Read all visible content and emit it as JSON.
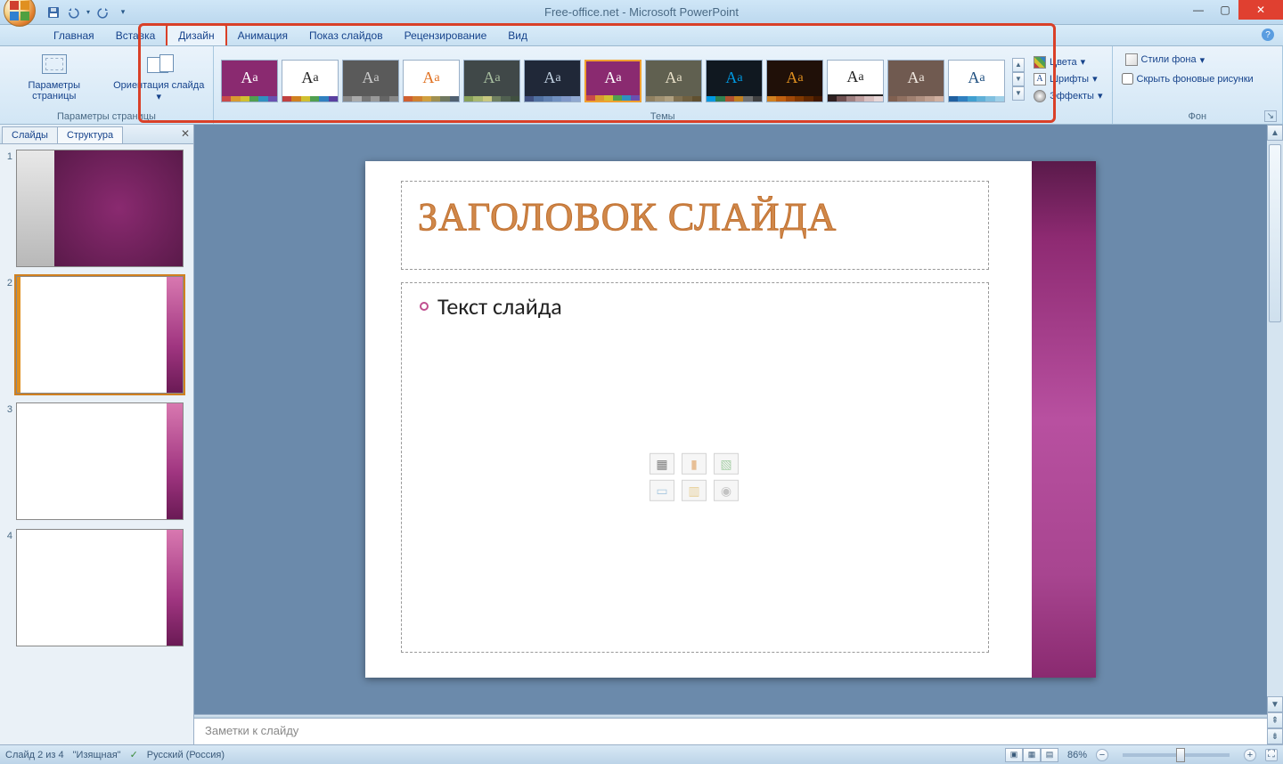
{
  "title": "Free-office.net - Microsoft PowerPoint",
  "tabs": {
    "home": "Главная",
    "insert": "Вставка",
    "design": "Дизайн",
    "animation": "Анимация",
    "slideshow": "Показ слайдов",
    "review": "Рецензирование",
    "view": "Вид"
  },
  "ribbon": {
    "page_setup_group": "Параметры страницы",
    "page_setup": "Параметры страницы",
    "orientation": "Ориентация слайда",
    "themes_group": "Темы",
    "colors": "Цвета",
    "fonts": "Шрифты",
    "effects": "Эффекты",
    "bg_group": "Фон",
    "bg_styles": "Стили фона",
    "hide_bg": "Скрыть фоновые рисунки"
  },
  "theme_thumbs": [
    {
      "bg": "#8a2a70",
      "fg": "#ffffff",
      "bar": [
        "#c94a4a",
        "#d99a30",
        "#d0c030",
        "#50a050",
        "#3090c0",
        "#6a50b0"
      ]
    },
    {
      "bg": "#ffffff",
      "fg": "#222222",
      "bar": [
        "#c04040",
        "#d08020",
        "#d0c030",
        "#50a050",
        "#3080c0",
        "#5a40a0"
      ]
    },
    {
      "bg": "#5a5a5a",
      "fg": "#cccccc",
      "bar": [
        "#888",
        "#aaa",
        "#777",
        "#999",
        "#666",
        "#888"
      ]
    },
    {
      "bg": "#ffffff",
      "fg": "#e07020",
      "bar": [
        "#d06030",
        "#d08030",
        "#d0a040",
        "#a09050",
        "#707860",
        "#506070"
      ]
    },
    {
      "bg": "#404848",
      "fg": "#a8bfa0",
      "bar": [
        "#88a058",
        "#a8b870",
        "#c8c880",
        "#708060",
        "#506050",
        "#405040"
      ]
    },
    {
      "bg": "#202838",
      "fg": "#c0d0e0",
      "bar": [
        "#405080",
        "#5070a0",
        "#6080b0",
        "#7090c0",
        "#8098c8",
        "#90a8d0"
      ]
    },
    {
      "bg": "#8a2a70",
      "fg": "#ffffff",
      "bar": [
        "#c94a4a",
        "#d99a30",
        "#d0c030",
        "#50a050",
        "#3090c0",
        "#6a50b0"
      ],
      "selected": true
    },
    {
      "bg": "#606050",
      "fg": "#e8e0c8",
      "bar": [
        "#908060",
        "#a09070",
        "#b0a080",
        "#807050",
        "#706040",
        "#605030"
      ]
    },
    {
      "bg": "#101820",
      "fg": "#0098e0",
      "bar": [
        "#0098e0",
        "#308050",
        "#b05030",
        "#c08020",
        "#707070",
        "#404040"
      ]
    },
    {
      "bg": "#201008",
      "fg": "#e09020",
      "bar": [
        "#d08020",
        "#c06010",
        "#a04808",
        "#803800",
        "#602800",
        "#401800"
      ]
    },
    {
      "bg": "#ffffff",
      "fg": "#222222",
      "bar": [
        "#302020",
        "#705050",
        "#a08080",
        "#c0a0a0",
        "#d8c0c0",
        "#e8d8d8"
      ],
      "under": true
    },
    {
      "bg": "#705a50",
      "fg": "#f0e8e0",
      "bar": [
        "#806050",
        "#907060",
        "#a08070",
        "#b09080",
        "#c0a090",
        "#d0b0a0"
      ]
    },
    {
      "bg": "#ffffff",
      "fg": "#205080",
      "bar": [
        "#2060a0",
        "#3080c0",
        "#40a0d0",
        "#60b0d8",
        "#80c0e0",
        "#a0d0e8"
      ]
    }
  ],
  "sidebar": {
    "tab_slides": "Слайды",
    "tab_outline": "Структура",
    "thumbs": [
      "1",
      "2",
      "3",
      "4"
    ]
  },
  "slide": {
    "title": "ЗАГОЛОВОК СЛАЙДА",
    "bullet": "Текст слайда"
  },
  "notes_placeholder": "Заметки к слайду",
  "status": {
    "slide": "Слайд 2 из 4",
    "theme": "\"Изящная\"",
    "lang": "Русский (Россия)",
    "zoom": "86%"
  }
}
